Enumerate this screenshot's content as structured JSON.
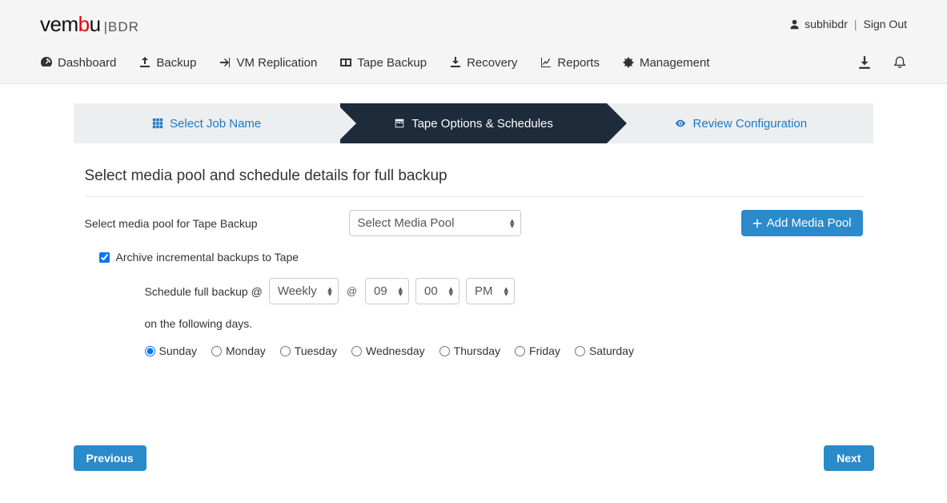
{
  "header": {
    "brand_prefix": "vem",
    "brand_b": "b",
    "brand_u": "u",
    "brand_suffix": "|BDR",
    "username": "subhibdr",
    "signout": "Sign Out"
  },
  "nav": {
    "dashboard": "Dashboard",
    "backup": "Backup",
    "vm_replication": "VM Replication",
    "tape_backup": "Tape Backup",
    "recovery": "Recovery",
    "reports": "Reports",
    "management": "Management"
  },
  "wizard": {
    "step1": "Select Job Name",
    "step2": "Tape Options & Schedules",
    "step3": "Review Configuration"
  },
  "section": {
    "title": "Select media pool and schedule details for full backup",
    "media_pool_label": "Select media pool for Tape Backup",
    "media_pool_selected": "Select Media Pool",
    "add_media_pool": "Add Media Pool",
    "archive_checkbox_label": "Archive incremental backups to Tape",
    "archive_checked": true,
    "schedule_prefix": "Schedule full backup @",
    "frequency_selected": "Weekly",
    "hour_selected": "09",
    "minute_selected": "00",
    "ampm_selected": "PM",
    "at_symbol": "@",
    "days_label": "on the following days.",
    "days": [
      "Sunday",
      "Monday",
      "Tuesday",
      "Wednesday",
      "Thursday",
      "Friday",
      "Saturday"
    ],
    "selected_day": "Sunday"
  },
  "footer": {
    "previous": "Previous",
    "next": "Next"
  }
}
